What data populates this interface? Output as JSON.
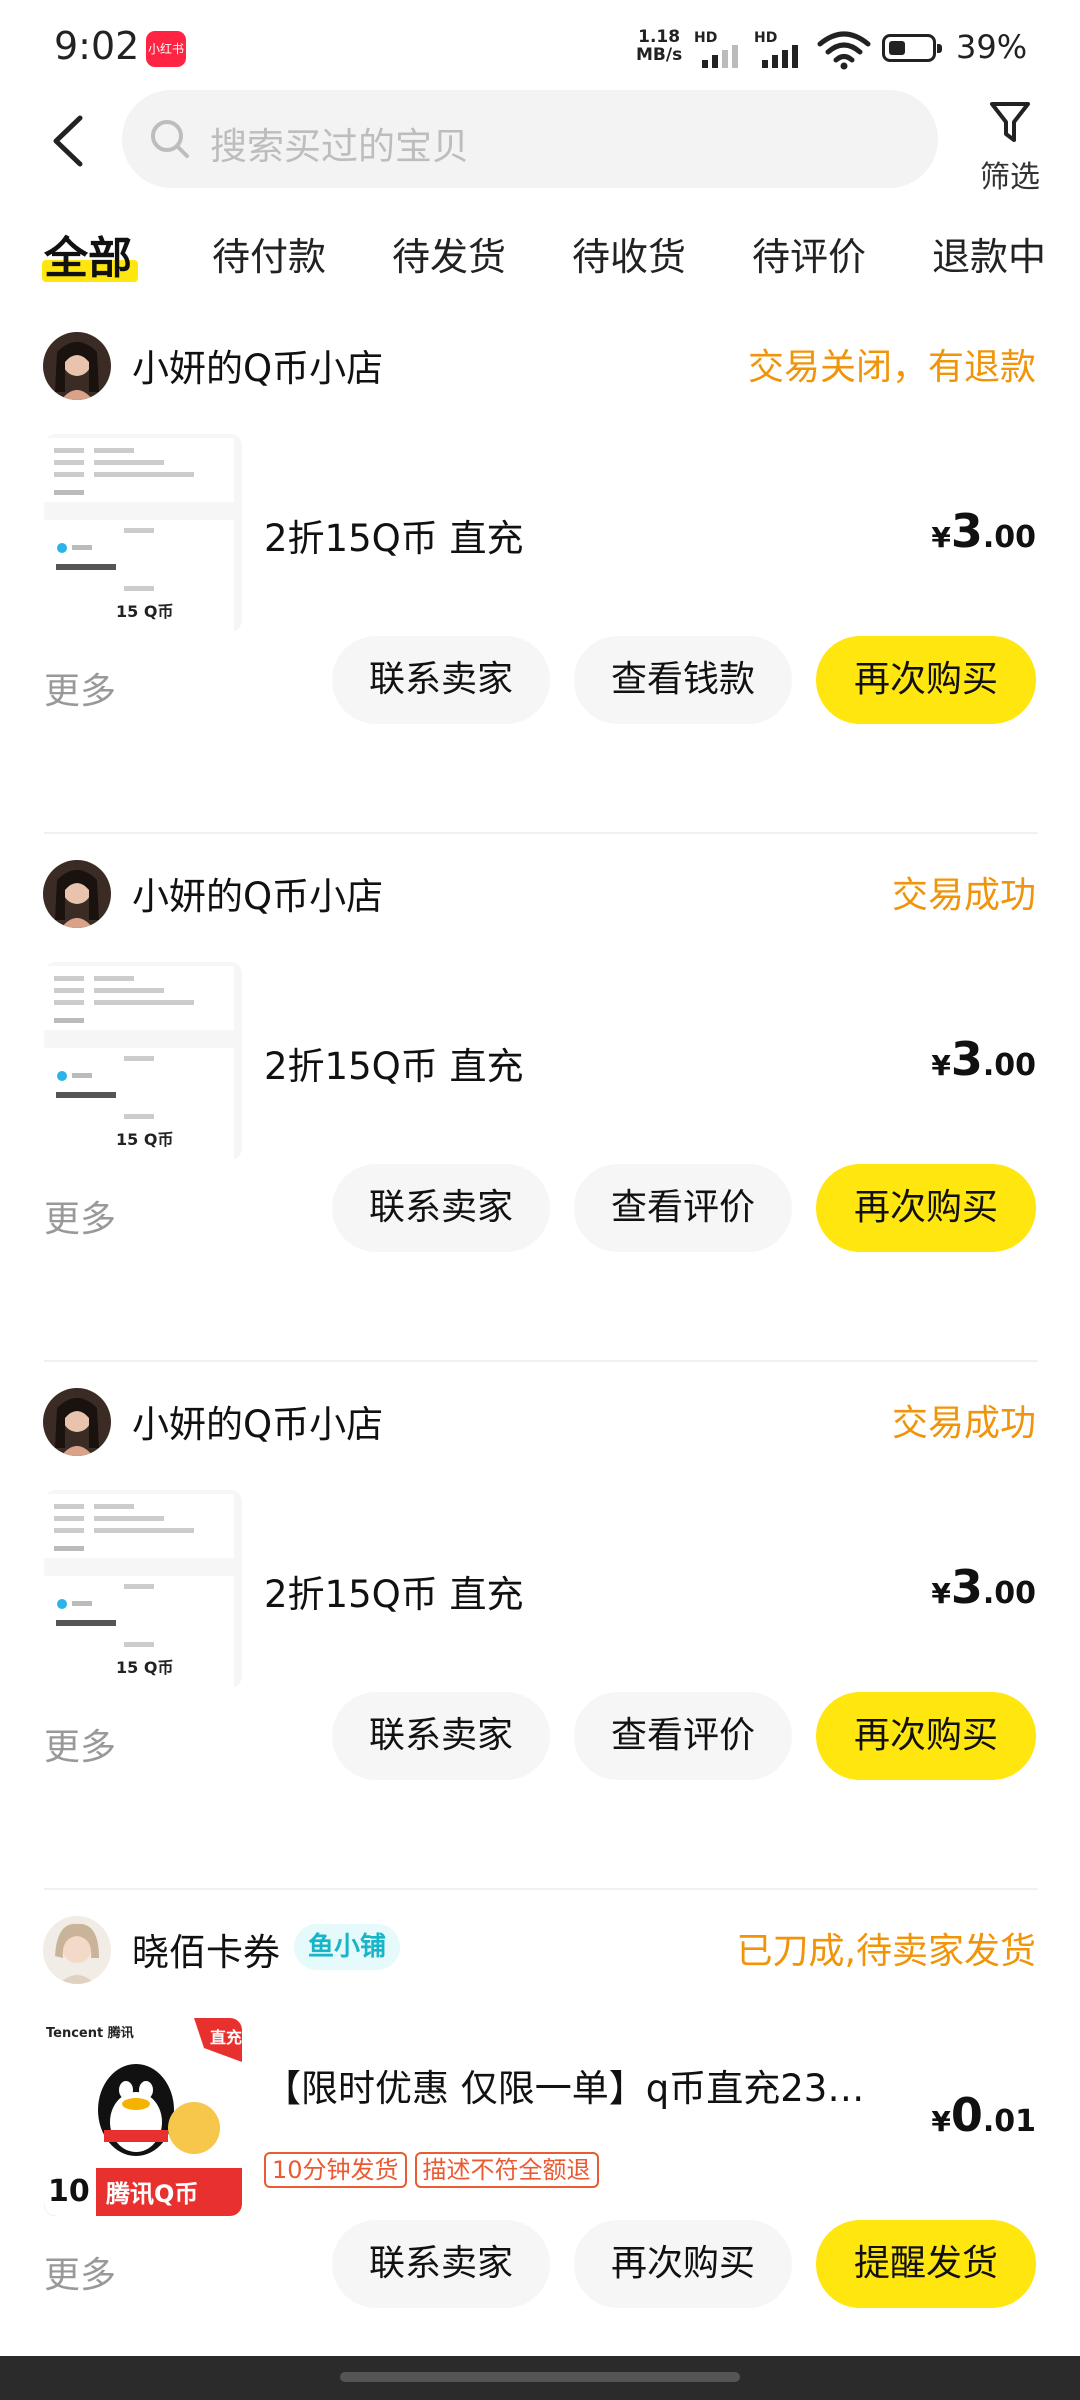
{
  "status_bar": {
    "time": "9:02",
    "app_badge": "小红书",
    "net_speed_value": "1.18",
    "net_speed_unit": "MB/s",
    "signal1_label": "HD",
    "signal2_label": "HD",
    "battery_percent": "39%",
    "battery_level": 0.39
  },
  "header": {
    "search_placeholder": "搜索买过的宝贝",
    "filter_label": "筛选"
  },
  "tabs": [
    {
      "label": "全部",
      "active": true
    },
    {
      "label": "待付款",
      "active": false
    },
    {
      "label": "待发货",
      "active": false
    },
    {
      "label": "待收货",
      "active": false
    },
    {
      "label": "待评价",
      "active": false
    },
    {
      "label": "退款中",
      "active": false
    }
  ],
  "orders": [
    {
      "shop_name": "小妍的Q币小店",
      "status": "交易关闭，有退款",
      "item_title": "2折15Q币 直充",
      "price_symbol": "¥",
      "price_int": "3",
      "price_dec": ".00",
      "thumb_caption": "15 Q币",
      "more_label": "更多",
      "buttons": [
        "联系卖家",
        "查看钱款",
        "再次购买"
      ]
    },
    {
      "shop_name": "小妍的Q币小店",
      "status": "交易成功",
      "item_title": "2折15Q币 直充",
      "price_symbol": "¥",
      "price_int": "3",
      "price_dec": ".00",
      "thumb_caption": "15 Q币",
      "more_label": "更多",
      "buttons": [
        "联系卖家",
        "查看评价",
        "再次购买"
      ]
    },
    {
      "shop_name": "小妍的Q币小店",
      "status": "交易成功",
      "item_title": "2折15Q币 直充",
      "price_symbol": "¥",
      "price_int": "3",
      "price_dec": ".00",
      "thumb_caption": "15 Q币",
      "more_label": "更多",
      "buttons": [
        "联系卖家",
        "查看评价",
        "再次购买"
      ]
    },
    {
      "shop_name": "晓佰卡券",
      "shop_tag": "鱼小铺",
      "status": "已刀成,待卖家发货",
      "item_title": "【限时优惠 仅限一单】q币直充23…",
      "price_symbol": "¥",
      "price_int": "0",
      "price_dec": ".01",
      "tags": [
        "10分钟发货",
        "描述不符全额退"
      ],
      "thumb_brand": "Tencent 腾讯",
      "thumb_corner": "直充",
      "thumb_number": "10",
      "thumb_title": "腾讯Q币",
      "more_label": "更多",
      "buttons": [
        "联系卖家",
        "再次购买",
        "提醒发货"
      ]
    }
  ],
  "colors": {
    "accent_yellow": "#ffe60f",
    "status_orange": "#f0940a",
    "tag_red": "#ec5a32",
    "shop_tag_teal": "#18b4c8"
  }
}
